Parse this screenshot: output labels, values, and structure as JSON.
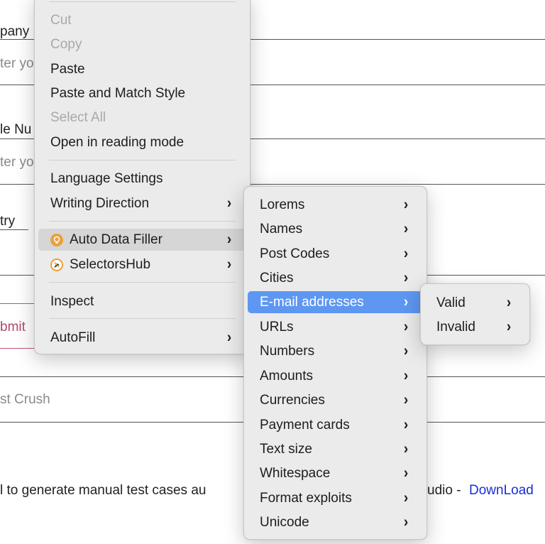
{
  "background": {
    "company_label": "pany",
    "company_placeholder": "ter yo",
    "phone_label": "le Nu",
    "phone_placeholder": "ter yo",
    "country_label": "try",
    "submit_label": "bmit",
    "crush_placeholder": "st Crush",
    "footer_text": "l to generate manual test cases au",
    "footer_text_right": "udio - ",
    "download_link": "DownLoad"
  },
  "context_menu": {
    "items": [
      {
        "label": "Cut",
        "disabled": true
      },
      {
        "label": "Copy",
        "disabled": true
      },
      {
        "label": "Paste",
        "disabled": false
      },
      {
        "label": "Paste and Match Style",
        "disabled": false
      },
      {
        "label": "Select All",
        "disabled": true
      },
      {
        "label": "Open in reading mode",
        "disabled": false
      },
      {
        "label": "Language Settings",
        "disabled": false
      },
      {
        "label": "Writing Direction",
        "submenu": true
      },
      {
        "label": "Auto Data Filler",
        "submenu": true,
        "icon": "auto-data-filler-icon",
        "hovered": true
      },
      {
        "label": "SelectorsHub",
        "submenu": true,
        "icon": "selectorshub-icon"
      },
      {
        "label": "Inspect",
        "disabled": false
      },
      {
        "label": "AutoFill",
        "submenu": true
      }
    ]
  },
  "auto_data_filler_submenu": {
    "items": [
      {
        "label": "Lorems"
      },
      {
        "label": "Names"
      },
      {
        "label": "Post Codes"
      },
      {
        "label": "Cities"
      },
      {
        "label": "E-mail addresses",
        "selected": true
      },
      {
        "label": "URLs"
      },
      {
        "label": "Numbers"
      },
      {
        "label": "Amounts"
      },
      {
        "label": "Currencies"
      },
      {
        "label": "Payment cards"
      },
      {
        "label": "Text size"
      },
      {
        "label": "Whitespace"
      },
      {
        "label": "Format exploits"
      },
      {
        "label": "Unicode"
      }
    ]
  },
  "email_submenu": {
    "items": [
      {
        "label": "Valid"
      },
      {
        "label": "Invalid"
      }
    ]
  },
  "chevron_glyph": "›",
  "colors": {
    "selected": "#5e97f2",
    "hover": "#d6d6d6",
    "menu_bg": "#ebebeb",
    "accent_pink": "#c0507a",
    "link": "#1a2fd6",
    "extension_icon": "#e9a13c"
  }
}
